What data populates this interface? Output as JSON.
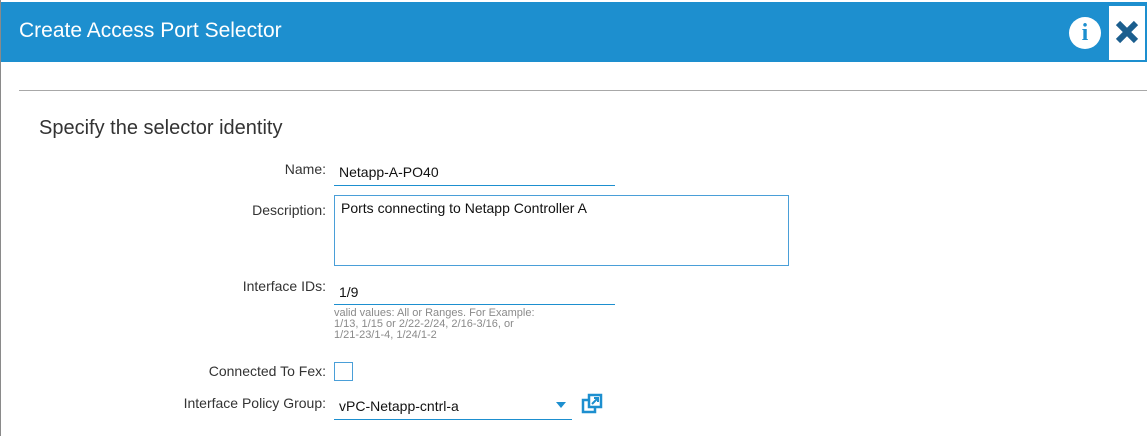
{
  "dialog": {
    "title": "Create Access Port Selector",
    "info_icon": "info-icon",
    "close_icon": "close-icon",
    "accent_color": "#1d8fcf"
  },
  "section": {
    "title": "Specify the selector identity"
  },
  "form": {
    "name": {
      "label": "Name:",
      "value": "Netapp-A-PO40"
    },
    "description": {
      "label": "Description:",
      "value": "Ports connecting to Netapp Controller A"
    },
    "interface_ids": {
      "label": "Interface IDs:",
      "value": "1/9",
      "hint_lines": [
        "valid values: All or Ranges. For Example:",
        "1/13, 1/15 or 2/22-2/24, 2/16-3/16, or",
        "1/21-23/1-4, 1/24/1-2"
      ]
    },
    "connected_to_fex": {
      "label": "Connected To Fex:",
      "checked": false
    },
    "interface_policy_group": {
      "label": "Interface Policy Group:",
      "value": "vPC-Netapp-cntrl-a",
      "dropdown_icon": "chevron-down-icon",
      "open_icon": "open-in-new-icon"
    }
  }
}
